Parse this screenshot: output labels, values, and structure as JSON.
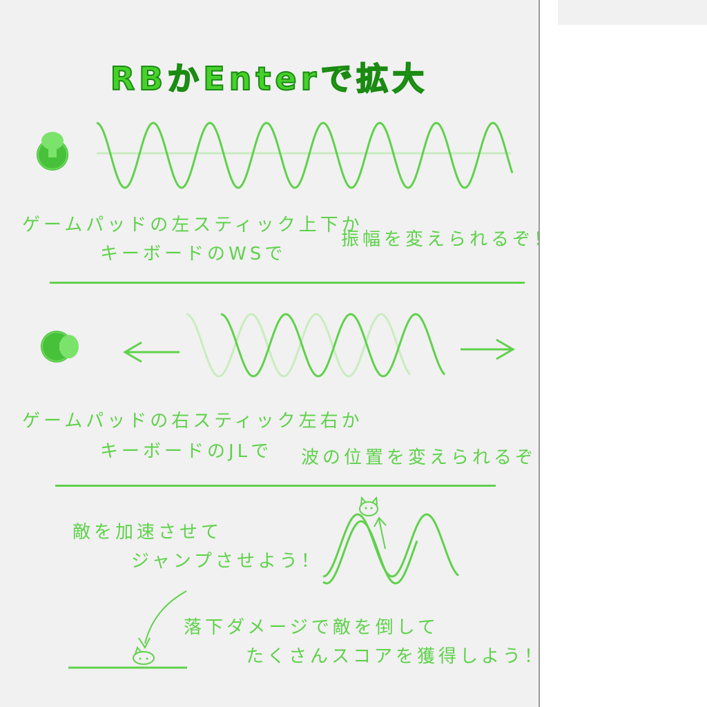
{
  "title": "RBかEnterで拡大",
  "section1": {
    "line1": "ゲームパッドの左スティック上下か",
    "line2": "キーボードのWSで",
    "result": "振幅を変えられるぞ！",
    "stick_icon": "left-stick-icon"
  },
  "section2": {
    "line1": "ゲームパッドの右スティック左右か",
    "line2": "キーボードのJLで",
    "result": "波の位置を変えられるぞ！",
    "stick_icon": "right-stick-icon"
  },
  "section3": {
    "line1": "敵を加速させて",
    "line2": "ジャンプさせよう！",
    "line3": "落下ダメージで敵を倒して",
    "line4": "たくさんスコアを獲得しよう！"
  },
  "colors": {
    "accent": "#5fd14b",
    "title_fill": "#47d12b",
    "title_stroke": "#1a8a12",
    "faint": "#c9ecc0"
  }
}
